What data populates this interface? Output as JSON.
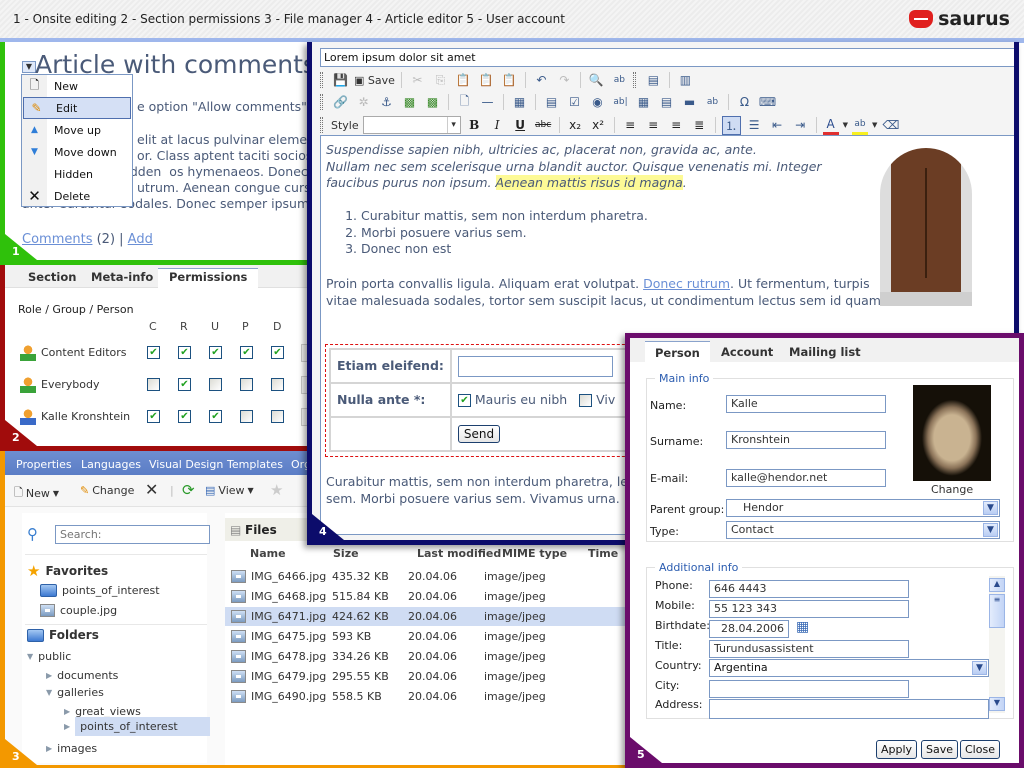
{
  "header": {
    "nav": "1 - Onsite editing  2 - Section permissions  3 - File manager  4 - Article editor  5 - User account",
    "logo": "saurus"
  },
  "panel1": {
    "badge": "1",
    "title": "Article with comments",
    "text_line1": "e option \"Allow comments\"",
    "text_lines": [
      "elit at lacus pulvinar element",
      "or. Class aptent taciti socios",
      "hidden os hymenaeos. Donec lacini",
      "utrum. Aenean congue cursu",
      "ante. Curabitur sodales. Donec semper ipsum"
    ],
    "comments_link": "Comments",
    "comments_count": " (2) | ",
    "add_link": "Add",
    "menu": [
      {
        "label": "New",
        "icon": "new-page-icon"
      },
      {
        "label": "Edit",
        "icon": "edit-pencil-icon",
        "selected": true
      },
      {
        "label": "Move up",
        "icon": "arrow-up-icon"
      },
      {
        "label": "Move down",
        "icon": "arrow-down-icon"
      },
      {
        "label": "Hidden",
        "icon": ""
      },
      {
        "label": "Delete",
        "icon": "delete-x-icon"
      }
    ]
  },
  "panel2": {
    "badge": "2",
    "tabs": [
      "Section",
      "Meta-info",
      "Permissions"
    ],
    "active_tab": "Permissions",
    "header": "Role / Group / Person",
    "columns": [
      "C",
      "R",
      "U",
      "P",
      "D"
    ],
    "rows": [
      {
        "name": "Content Editors",
        "type": "group",
        "perms": [
          true,
          true,
          true,
          true,
          true
        ]
      },
      {
        "name": "Everybody",
        "type": "group",
        "perms": [
          false,
          true,
          false,
          false,
          false
        ]
      },
      {
        "name": "Kalle Kronshtein",
        "type": "person",
        "perms": [
          true,
          true,
          true,
          false,
          false
        ]
      }
    ]
  },
  "panel3": {
    "badge": "3",
    "menu": [
      "Properties",
      "Languages",
      "Visual Design",
      "Templates",
      "Org"
    ],
    "toolbar": {
      "new": "New",
      "change": "Change",
      "view": "View"
    },
    "search_placeholder": "Search:",
    "favorites_label": "Favorites",
    "favorites": [
      {
        "name": "points_of_interest",
        "type": "folder"
      },
      {
        "name": "couple.jpg",
        "type": "image"
      }
    ],
    "folders_label": "Folders",
    "tree": [
      {
        "name": "public",
        "level": 0,
        "expanded": true
      },
      {
        "name": "documents",
        "level": 1,
        "expanded": false
      },
      {
        "name": "galleries",
        "level": 1,
        "expanded": true
      },
      {
        "name": "great_views",
        "level": 2,
        "expanded": false
      },
      {
        "name": "points_of_interest",
        "level": 2,
        "expanded": false,
        "selected": true
      },
      {
        "name": "images",
        "level": 1,
        "expanded": false
      }
    ],
    "files_title": "Files",
    "columns": [
      "Name",
      "Size",
      "Last modified",
      "MIME type",
      "Time"
    ],
    "files": [
      {
        "name": "IMG_6466.jpg",
        "size": "435.32 KB",
        "modified": "20.04.06",
        "mime": "image/jpeg"
      },
      {
        "name": "IMG_6468.jpg",
        "size": "515.84 KB",
        "modified": "20.04.06",
        "mime": "image/jpeg"
      },
      {
        "name": "IMG_6471.jpg",
        "size": "424.62 KB",
        "modified": "20.04.06",
        "mime": "image/jpeg",
        "selected": true
      },
      {
        "name": "IMG_6475.jpg",
        "size": "593 KB",
        "modified": "20.04.06",
        "mime": "image/jpeg"
      },
      {
        "name": "IMG_6478.jpg",
        "size": "334.26 KB",
        "modified": "20.04.06",
        "mime": "image/jpeg"
      },
      {
        "name": "IMG_6479.jpg",
        "size": "295.55 KB",
        "modified": "20.04.06",
        "mime": "image/jpeg"
      },
      {
        "name": "IMG_6490.jpg",
        "size": "558.5 KB",
        "modified": "20.04.06",
        "mime": "image/jpeg"
      }
    ]
  },
  "panel4": {
    "badge": "4",
    "title_value": "Lorem ipsum dolor sit amet",
    "save_label": "Save",
    "style_label": "Style",
    "para1_italic": "Suspendisse sapien nibh, ultricies ac, placerat non, gravida ac, ante.",
    "para1_text": "Nullam nec sem scelerisque urna blandit auctor. Quisque venenatis mi. Integer faucibus purus non ipsum. ",
    "para1_highlight": "Aenean mattis risus id magna",
    "list": [
      "Curabitur mattis, sem non interdum pharetra.",
      "Morbi posuere varius sem.",
      "Donec non est"
    ],
    "para2_a": "Proin porta convallis ligula. Aliquam erat volutpat. ",
    "para2_link": "Donec rutrum",
    "para2_b": ". Ut fermentum, turpis vitae malesuada sodales, tortor sem suscipit lacus, ut condimentum lectus sem id quam.",
    "form": {
      "label1": "Etiam eleifend:",
      "label2": "Nulla ante *:",
      "check1": "Mauris eu nibh",
      "check1_checked": true,
      "check2": "Viv",
      "check2_checked": false,
      "send": "Send"
    },
    "para3": "Curabitur mattis, sem non interdum pharetra, le sem. Morbi posuere varius sem. Vivamus urna."
  },
  "panel5": {
    "badge": "5",
    "tabs": [
      "Person",
      "Account",
      "Mailing list"
    ],
    "active_tab": "Person",
    "main_legend": "Main info",
    "name_label": "Name:",
    "name": "Kalle",
    "surname_label": "Surname:",
    "surname": "Kronshtein",
    "email_label": "E-mail:",
    "email": "kalle@hendor.net",
    "change_photo": "Change",
    "parent_label": "Parent group:",
    "parent": "Hendor",
    "type_label": "Type:",
    "type": "Contact",
    "additional_legend": "Additional info",
    "phone_label": "Phone:",
    "phone": "646 4443",
    "mobile_label": "Mobile:",
    "mobile": "55 123 343",
    "birth_label": "Birthdate:",
    "birth": "28.04.2006",
    "title_label": "Title:",
    "title": "Turundusassistent",
    "country_label": "Country:",
    "country": "Argentina",
    "city_label": "City:",
    "city": "",
    "address_label": "Address:",
    "address": "",
    "apply": "Apply",
    "save": "Save",
    "close": "Close"
  }
}
